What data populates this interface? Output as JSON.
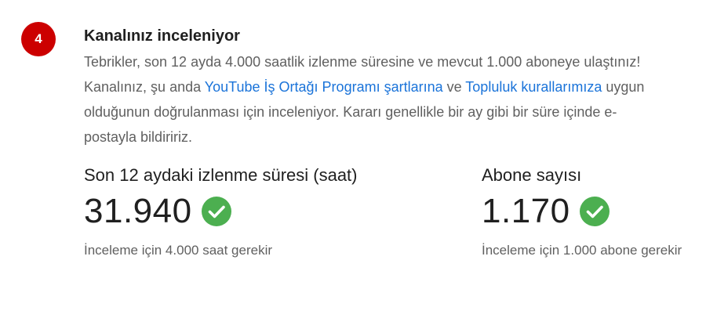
{
  "step": {
    "number": "4",
    "color": "#cc0000"
  },
  "review": {
    "title": "Kanalınız inceleniyor",
    "desc_part1": "Tebrikler, son 12 ayda 4.000 saatlik izlenme süresine ve mevcut 1.000 aboneye ulaştınız! Kanalınız, şu anda ",
    "link1": "YouTube İş Ortağı Programı şartlarına",
    "desc_part2": " ve ",
    "link2": "Topluluk kurallarımıza",
    "desc_part3": " uygun olduğunun doğrulanması için inceleniyor. Kararı genellikle bir ay gibi bir süre içinde e-postayla bildiririz.",
    "link_color": "#1a73d9"
  },
  "stats": {
    "watch_time": {
      "label": "Son 12 aydaki izlenme süresi (saat)",
      "value": "31.940",
      "note": "İnceleme için 4.000 saat gerekir",
      "icon": "check-circle-icon"
    },
    "subscribers": {
      "label": "Abone sayısı",
      "value": "1.170",
      "note": "İnceleme için 1.000 abone gerekir",
      "icon": "check-circle-icon"
    },
    "check_color": "#4caf50"
  }
}
